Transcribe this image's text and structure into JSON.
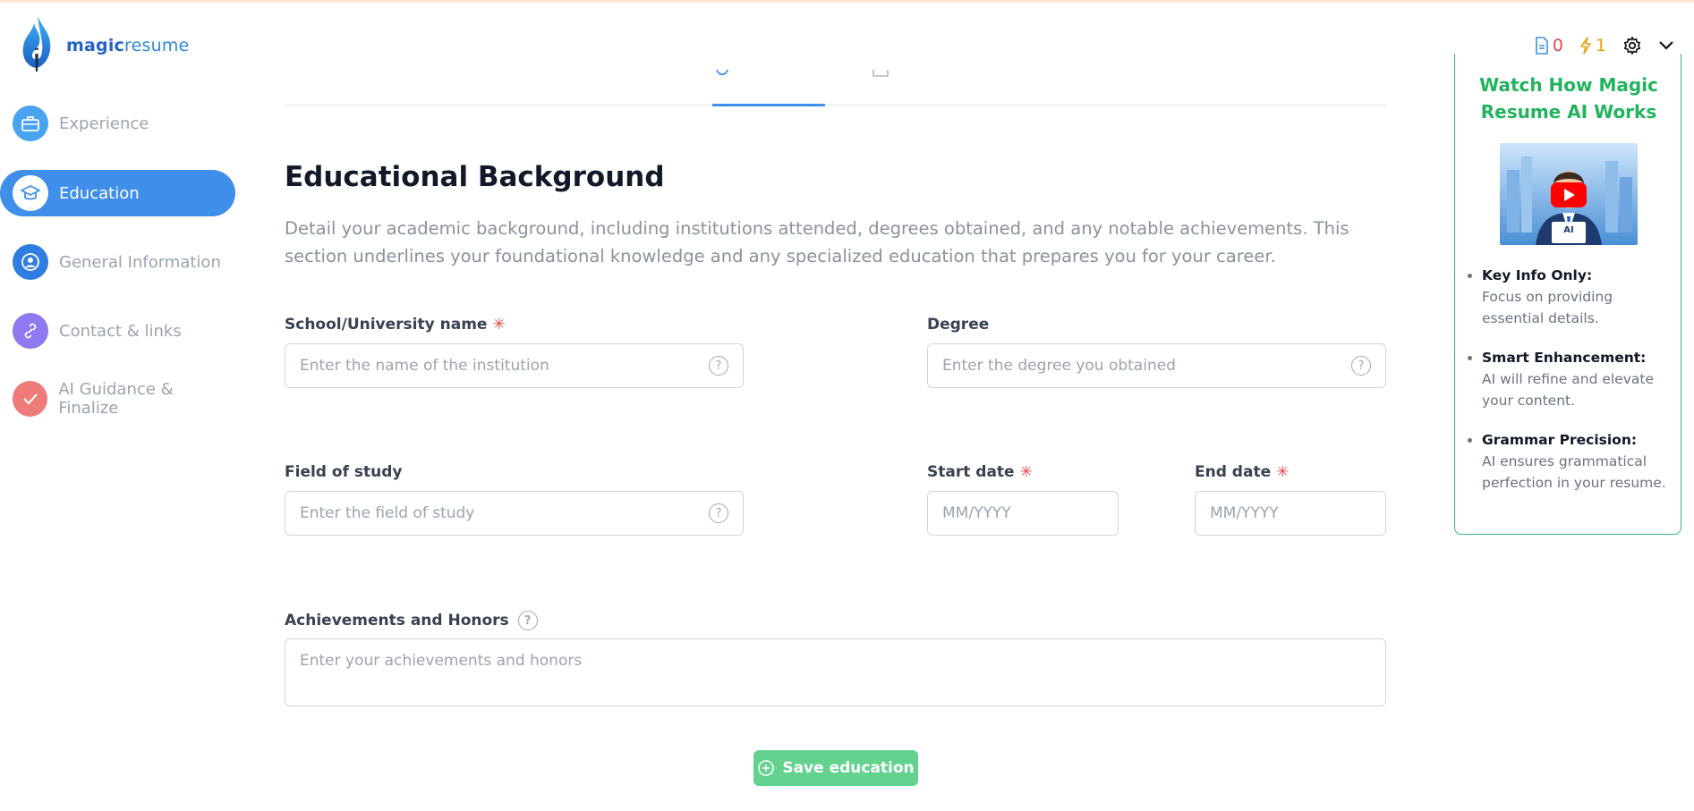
{
  "app": {
    "logo_text_bold": "magic",
    "logo_text_rest": "resume"
  },
  "header": {
    "doc_count": "0",
    "credits": "1"
  },
  "sidebar": {
    "items": [
      {
        "label": "Experience",
        "icon": "briefcase-icon",
        "color": "#4aa3f0"
      },
      {
        "label": "Education",
        "icon": "graduation-cap-icon",
        "color": "#3f8ee9",
        "active": true
      },
      {
        "label": "General Information",
        "icon": "user-icon",
        "color": "#2f7de0"
      },
      {
        "label": "Contact & links",
        "icon": "link-icon",
        "color": "#8f78f0"
      },
      {
        "label": "AI Guidance & Finalize",
        "icon": "check-icon",
        "color": "#ef7b7b"
      }
    ]
  },
  "main": {
    "title": "Educational Background",
    "description": "Detail your academic background, including institutions attended, degrees obtained, and any notable achievements. This section underlines your foundational knowledge and any specialized education that prepares you for your career.",
    "fields": {
      "school": {
        "label": "School/University name",
        "placeholder": "Enter the name of the institution"
      },
      "degree": {
        "label": "Degree",
        "placeholder": "Enter the degree you obtained"
      },
      "field_of_study": {
        "label": "Field of study",
        "placeholder": "Enter the field of study"
      },
      "start_date": {
        "label": "Start date",
        "placeholder": "MM/YYYY"
      },
      "end_date": {
        "label": "End date",
        "placeholder": "MM/YYYY"
      },
      "achievements": {
        "label": "Achievements and Honors",
        "placeholder": "Enter your achievements and honors"
      }
    },
    "save_label": "Save education"
  },
  "promo": {
    "title": "Watch How Magic Resume AI Works",
    "tips": [
      {
        "key": "Key Info Only:",
        "text": "Focus on providing essential details."
      },
      {
        "key": "Smart Enhancement:",
        "text": "AI will refine and elevate your content."
      },
      {
        "key": "Grammar Precision:",
        "text": "AI ensures grammatical perfection in your resume."
      }
    ],
    "video_badge": "AI"
  },
  "colors": {
    "accent": "#3f8ee9",
    "save": "#63d28e",
    "promo_green": "#22b35e",
    "required": "#e0474c"
  }
}
